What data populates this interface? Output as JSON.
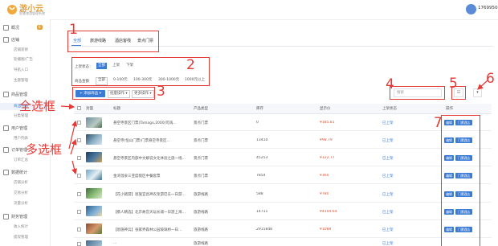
{
  "header": {
    "logo_text": "游小云",
    "logo_sub": "智慧旅游管理系统",
    "user_phone": "176995066"
  },
  "sidebar": {
    "items": [
      {
        "label": "概况",
        "badge": "6"
      },
      {
        "label": "店铺"
      },
      {
        "label": "店铺装修"
      },
      {
        "label": "轮播图/广告"
      },
      {
        "label": "导航入口"
      },
      {
        "label": "主题管理"
      },
      {
        "label": "商品管理"
      },
      {
        "label": "商品列表"
      },
      {
        "label": "分类管理"
      },
      {
        "label": "用户管理"
      },
      {
        "label": "用户列表"
      },
      {
        "label": "订单管理"
      },
      {
        "label": "订单汇总"
      },
      {
        "label": "数据统计"
      },
      {
        "label": "店铺分析"
      },
      {
        "label": "交易分析"
      },
      {
        "label": "流量分析"
      },
      {
        "label": "财务管理"
      },
      {
        "label": "收入统计"
      },
      {
        "label": "提现管理"
      }
    ]
  },
  "tabs": [
    "全部",
    "旅游线路",
    "酒店客栈",
    "景点门票"
  ],
  "filters": {
    "status_label": "上架状态：",
    "status_options": [
      "全部",
      "上架",
      "下架"
    ],
    "price_label": "商品金额",
    "price_options": [
      "全部",
      "0-100元",
      "100-300元",
      "300-1000元",
      "1000元以上"
    ]
  },
  "toolbar": {
    "add_label": "+ 添加商品 ▾",
    "batch_label": "批量操作 ▾",
    "more_label": "更多操作 ▾",
    "search_placeholder": "搜索",
    "view_toggle": "☷",
    "col_toggle": "▾"
  },
  "table": {
    "headers": [
      "封面",
      "标题",
      "产品类型",
      "库存",
      "显示价",
      "上架状态",
      "操作"
    ],
    "rows": [
      {
        "title": "悬空寺景区门票(Tamago,2000)可再…",
        "type": "景点门票",
        "stock": "0",
        "price": "¥185.81",
        "status": "已上架"
      },
      {
        "title": "悬空寺(恒山门票)门票悬空寺景区…",
        "type": "景点门票",
        "stock": "13410",
        "price": "¥98.79",
        "status": "已上架"
      },
      {
        "title": "悬空寺景区内部中文解说文化体验之旅一线…",
        "type": "景点门票",
        "stock": "45253",
        "price": "¥122.77",
        "status": "已上架"
      },
      {
        "title": "金湾温泉三亚度假区中餐套票",
        "type": "景点门票",
        "stock": "7854",
        "price": "¥160",
        "status": "已上架"
      },
      {
        "title": "【花小猪游】恩施宜昌神农架游巴东一日游…",
        "type": "旅游线路",
        "stock": "588",
        "price": "¥780",
        "status": "已上架"
      },
      {
        "title": "【携人精选】北京故宫天坛长城一日游上海…",
        "type": "旅游线路",
        "stock": "14711",
        "price": "¥4104.64",
        "status": "已上架"
      },
      {
        "title": "【恩施神兵】张家界森林公园玻璃桥一日…",
        "type": "旅游线路",
        "stock": "2915848",
        "price": "¥1089",
        "status": "已上架"
      },
      {
        "title": "…",
        "type": "旅游线路",
        "stock": "…",
        "price": "¥…",
        "status": "已上架"
      }
    ],
    "op_edit": "编辑",
    "op_related": "门票酒店"
  },
  "annotations": {
    "numbers": [
      "1",
      "2",
      "3",
      "4",
      "5",
      "6",
      "7"
    ],
    "select_all": "全选框",
    "multi_select": "多选框"
  },
  "colors": {
    "accent": "#3a7bd5",
    "annotation": "#e53935",
    "logo": "#e6a23c",
    "price": "#e6502e"
  }
}
